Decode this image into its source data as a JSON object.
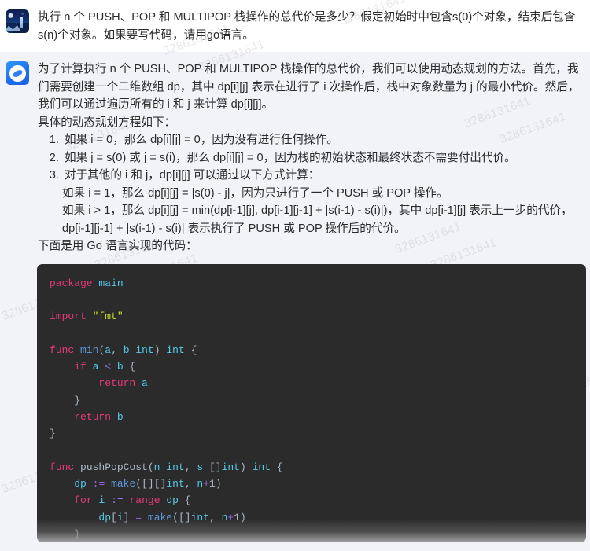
{
  "watermark": {
    "text": "3286131641"
  },
  "colors": {
    "user_bg": "#ffffff",
    "assistant_bg": "#f2f3f8",
    "code_bg": "#2b2b2b",
    "text": "#2b2b2b",
    "keyword": "#e5397c",
    "identifier": "#56c8e8",
    "string": "#c3d82c",
    "operator": "#9a6ae1",
    "builtin": "#5f9ae0"
  },
  "messages": {
    "user": {
      "avatar_name": "user-avatar",
      "paragraph": "执行 n 个 PUSH、POP 和 MULTIPOP 栈操作的总代价是多少？假定初始时中包含s(0)个对象，结束后包含s(n)个对象。如果要写代码，请用go语言。"
    },
    "assistant": {
      "avatar_name": "assistant-avatar",
      "intro": "为了计算执行 n 个 PUSH、POP 和 MULTIPOP 栈操作的总代价，我们可以使用动态规划的方法。首先，我们需要创建一个二维数组 dp，其中 dp[i][j] 表示在进行了 i 次操作后，栈中对象数量为 j 的最小代价。然后，我们可以通过遍历所有的 i 和 j 来计算 dp[i][j]。",
      "equations_heading": "具体的动态规划方程如下：",
      "steps": [
        "如果 i = 0，那么 dp[i][j] = 0，因为没有进行任何操作。",
        "如果 j = s(0) 或 j = s(i)，那么 dp[i][j] = 0，因为栈的初始状态和最终状态不需要付出代价。",
        "对于其他的 i 和 j，dp[i][j] 可以通过以下方式计算："
      ],
      "substeps": [
        "如果 i = 1，那么 dp[i][j] = |s(0) - j|，因为只进行了一个 PUSH 或 POP 操作。",
        "如果 i > 1，那么 dp[i][j] = min(dp[i-1][j], dp[i-1][j-1] + |s(i-1) - s(i)|)，其中 dp[i-1][j] 表示上一步的代价，dp[i-1][j-1] + |s(i-1) - s(i)| 表示执行了 PUSH 或 POP 操作后的代价。"
      ],
      "code_intro": "下面是用 Go 语言实现的代码：",
      "code": {
        "language": "go",
        "lines": [
          "package main",
          "",
          "import \"fmt\"",
          "",
          "func min(a, b int) int {",
          "    if a < b {",
          "        return a",
          "    }",
          "    return b",
          "}",
          "",
          "func pushPopCost(n int, s []int) int {",
          "    dp := make([][]int, n+1)",
          "    for i := range dp {",
          "        dp[i] = make([]int, n+1)",
          "    }"
        ]
      }
    }
  }
}
